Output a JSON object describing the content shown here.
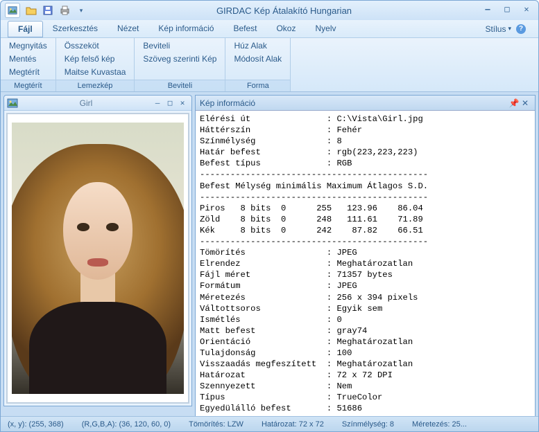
{
  "app": {
    "title": "GIRDAC Kép Átalakító Hungarian"
  },
  "menu": {
    "items": [
      "Fájl",
      "Szerkesztés",
      "Nézet",
      "Kép információ",
      "Befest",
      "Okoz",
      "Nyelv"
    ],
    "active_index": 0,
    "style_label": "Stílus"
  },
  "ribbon": {
    "groups": [
      {
        "label": "Megtérít",
        "items": [
          "Megnyitás",
          "Mentés",
          "Megtérít"
        ]
      },
      {
        "label": "Lemezkép",
        "items": [
          "Összeköt",
          "Kép felső kép",
          "Maitse Kuvastaa"
        ]
      },
      {
        "label": "Beviteli",
        "items": [
          "Beviteli",
          "Szöveg szerinti Kép"
        ]
      },
      {
        "label": "Forma",
        "items": [
          "Húz Alak",
          "Módosít Alak"
        ]
      }
    ]
  },
  "child_window": {
    "title": "Girl"
  },
  "info_panel": {
    "title": "Kép információ",
    "props1": [
      [
        "Elérési út",
        "C:\\Vista\\Girl.jpg"
      ],
      [
        "Háttérszín",
        "Fehér"
      ],
      [
        "Színmélység",
        "8"
      ],
      [
        "Határ befest",
        "rgb(223,223,223)"
      ],
      [
        "Befest típus",
        "RGB"
      ]
    ],
    "stats_header": "Befest Mélység minimális Maximum Átlagos S.D.",
    "stats": [
      [
        "Piros",
        "8 bits",
        "0",
        "255",
        "123.96",
        "86.04"
      ],
      [
        "Zöld",
        "8 bits",
        "0",
        "248",
        "111.61",
        "71.89"
      ],
      [
        "Kék",
        "8 bits",
        "0",
        "242",
        "87.82",
        "66.51"
      ]
    ],
    "props2": [
      [
        "Tömörítés",
        "JPEG"
      ],
      [
        "Elrendez",
        "Meghatározatlan"
      ],
      [
        "Fájl méret",
        "71357 bytes"
      ],
      [
        "Formátum",
        "JPEG"
      ],
      [
        "Méretezés",
        "256 x 394 pixels"
      ],
      [
        "Váltottsoros",
        "Egyik sem"
      ],
      [
        "Ismétlés",
        "0"
      ],
      [
        "Matt befest",
        "gray74"
      ],
      [
        "Orientáció",
        "Meghatározatlan"
      ],
      [
        "Tulajdonság",
        "100"
      ],
      [
        "Visszaadás megfeszített",
        "Meghatározatlan"
      ],
      [
        "Határozat",
        "72 x 72 DPI"
      ],
      [
        "Szennyezett",
        "Nem"
      ],
      [
        "Típus",
        "TrueColor"
      ],
      [
        "Egyedülálló befest",
        "51686"
      ]
    ]
  },
  "statusbar": {
    "xy": "(x, y): (255, 368)",
    "rgba": "(R,G,B,A): (36, 120, 60, 0)",
    "compression": "Tömörítés: LZW",
    "resolution": "Határozat: 72 x 72",
    "depth": "Színmélység: 8",
    "size": "Méretezés: 25..."
  }
}
